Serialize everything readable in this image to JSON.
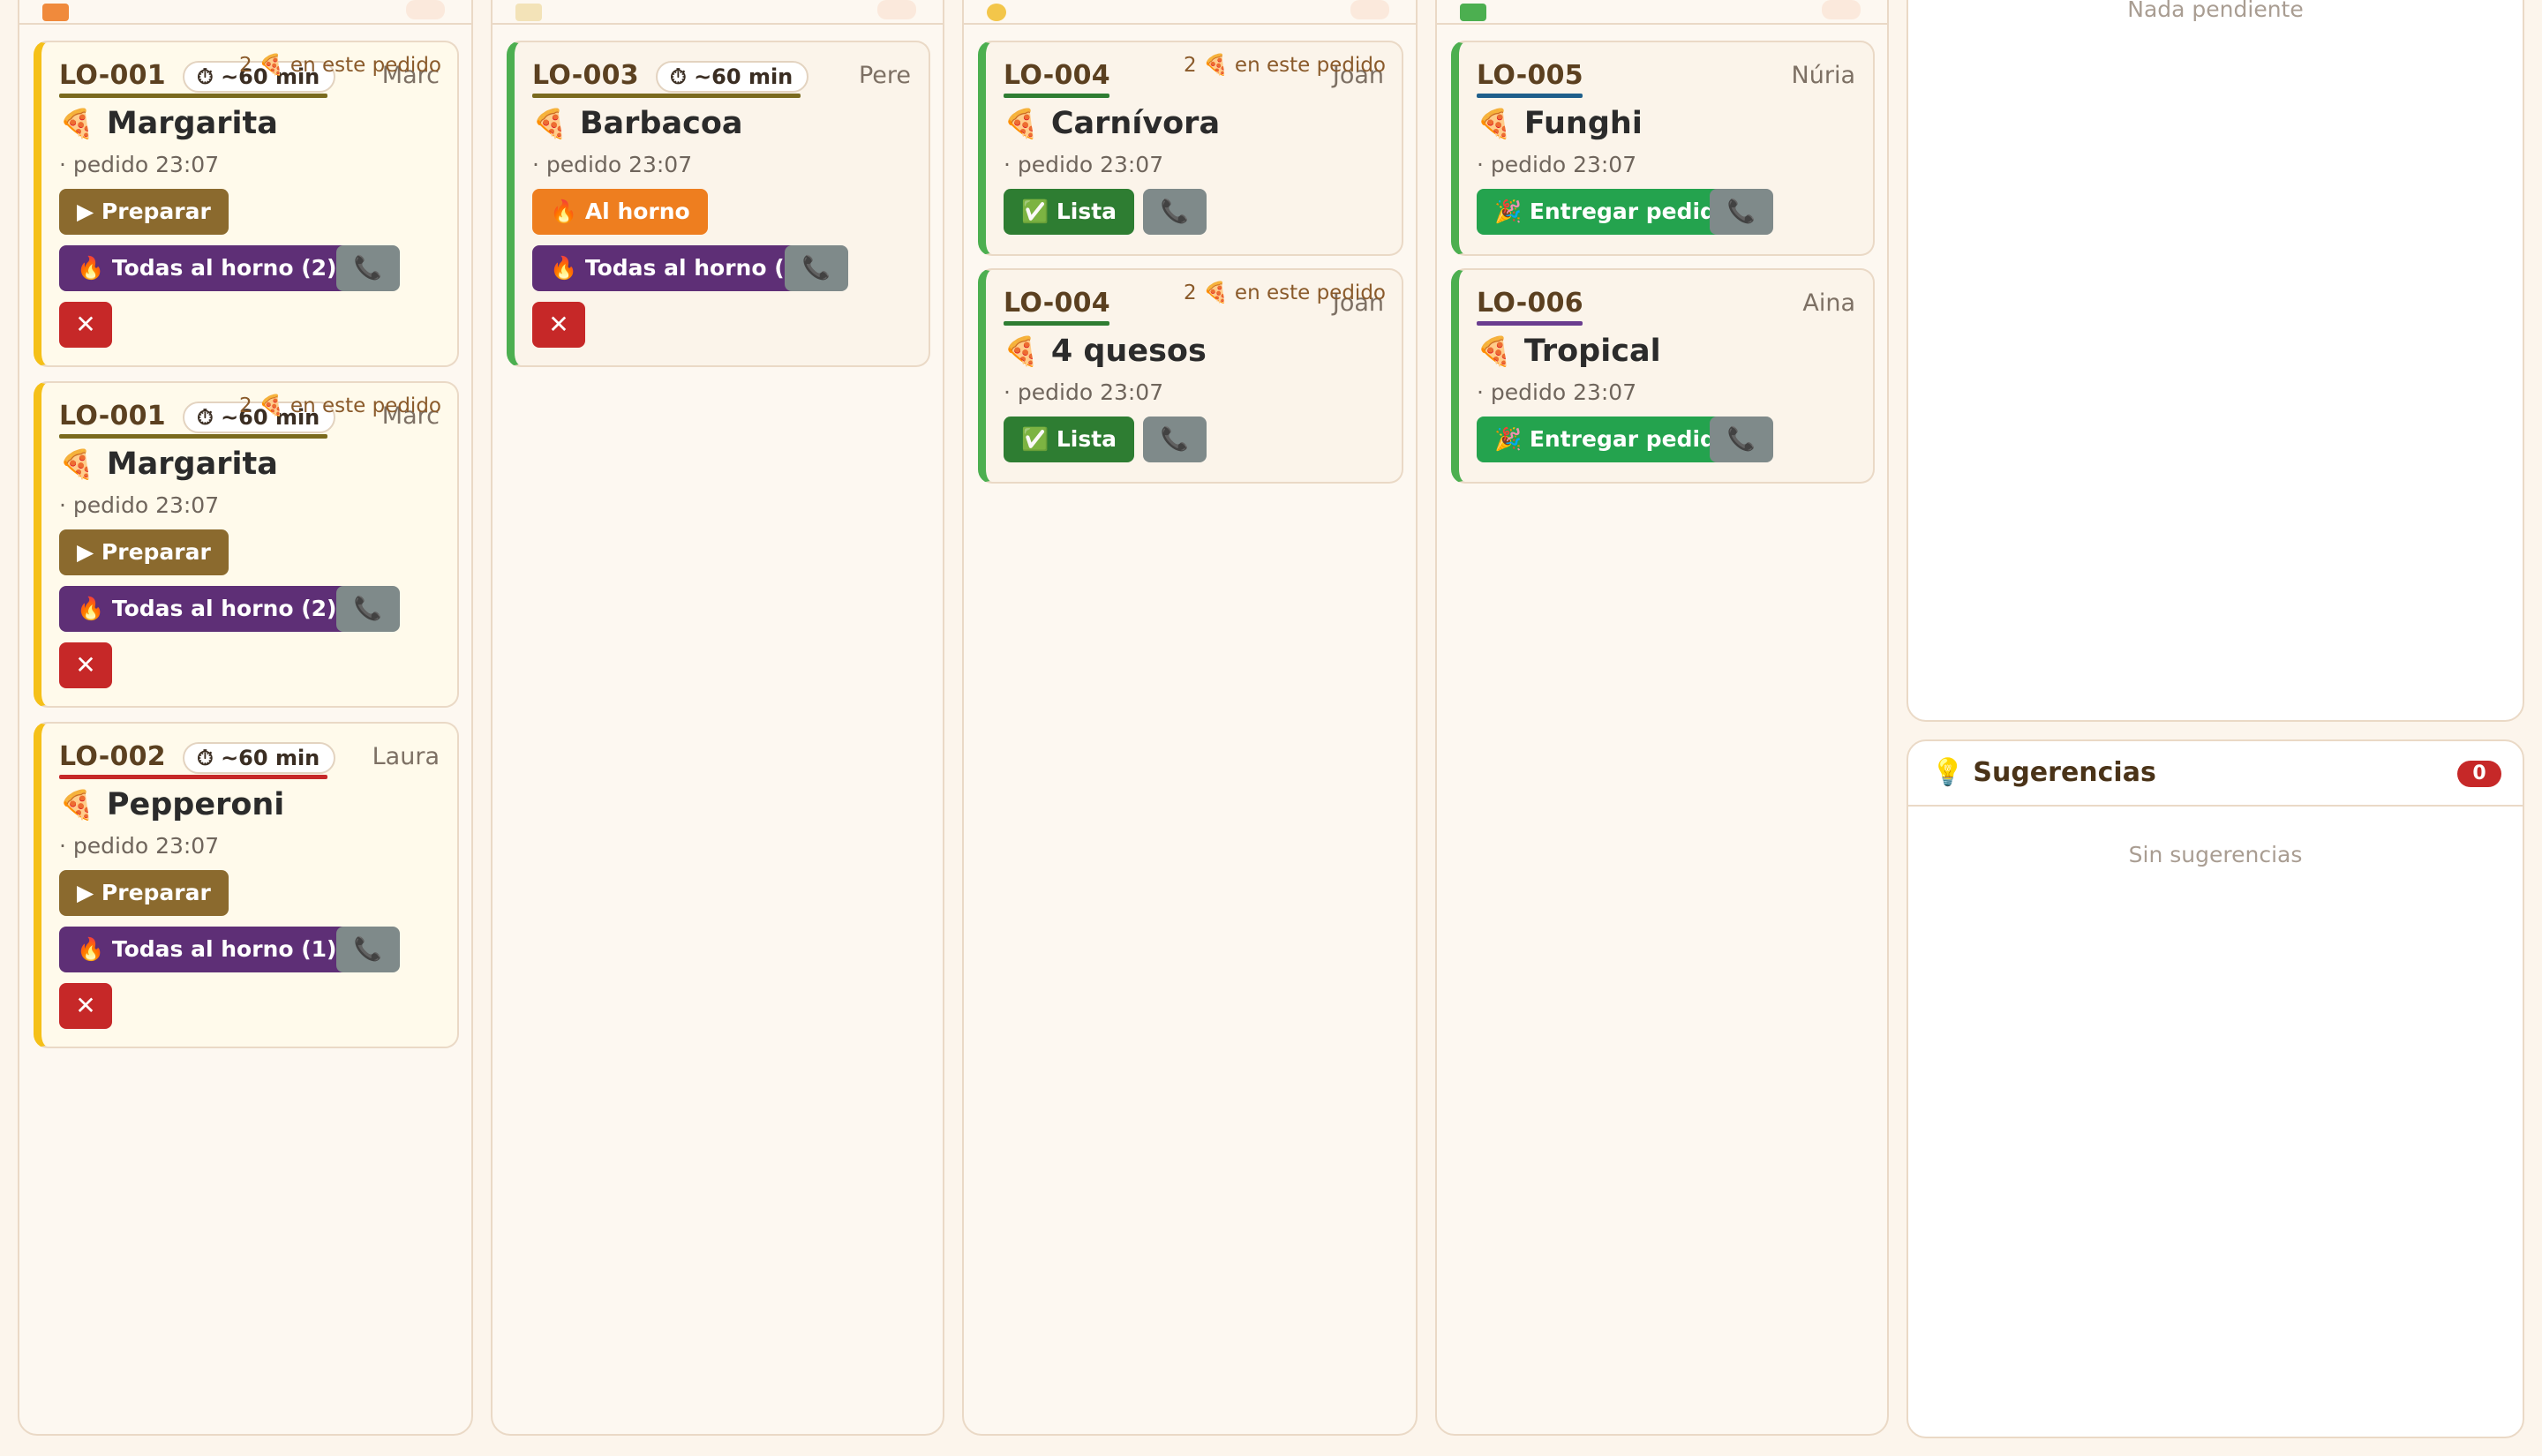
{
  "columns": {
    "pending": {
      "icon_color": "#f08a3c",
      "cards": [
        {
          "id": "LO-001",
          "underline_color": "#7a6a1e",
          "eta": "⏱ ~60 min",
          "customer": "Marc",
          "in_order": "2 🍕 en este pedido",
          "pizza_icon": "🍕",
          "pizza": "Margarita",
          "ordered_at": "· pedido 23:07",
          "prepare_label": "▶ Preparar",
          "oven_all_label": "🔥 Todas al horno (2)",
          "phone_icon": "📞",
          "cancel_label": "✕"
        },
        {
          "id": "LO-001",
          "underline_color": "#7a6a1e",
          "eta": "⏱ ~60 min",
          "customer": "Marc",
          "in_order": "2 🍕 en este pedido",
          "pizza_icon": "🍕",
          "pizza": "Margarita",
          "ordered_at": "· pedido 23:07",
          "prepare_label": "▶ Preparar",
          "oven_all_label": "🔥 Todas al horno (2)",
          "phone_icon": "📞",
          "cancel_label": "✕"
        },
        {
          "id": "LO-002",
          "underline_color": "#c62828",
          "eta": "⏱ ~60 min",
          "customer": "Laura",
          "pizza_icon": "🍕",
          "pizza": "Pepperoni",
          "ordered_at": "· pedido 23:07",
          "prepare_label": "▶ Preparar",
          "oven_all_label": "🔥 Todas al horno (1)",
          "phone_icon": "📞",
          "cancel_label": "✕"
        }
      ]
    },
    "preparing": {
      "icon_color": "#f3e3b8",
      "cards": [
        {
          "id": "LO-003",
          "underline_color": "#7a6a1e",
          "eta": "⏱ ~60 min",
          "customer": "Pere",
          "pizza_icon": "🍕",
          "pizza": "Barbacoa",
          "ordered_at": "· pedido 23:07",
          "oven_label": "🔥 Al horno",
          "oven_all_label": "🔥 Todas al horno (1)",
          "phone_icon": "📞",
          "cancel_label": "✕"
        }
      ]
    },
    "oven": {
      "icon_color": "#f3c64a",
      "cards": [
        {
          "id": "LO-004",
          "underline_color": "#2e7d32",
          "customer": "Joan",
          "in_order": "2 🍕 en este pedido",
          "pizza_icon": "🍕",
          "pizza": "Carnívora",
          "ordered_at": "· pedido 23:07",
          "ready_label": "✅ Lista",
          "phone_icon": "📞"
        },
        {
          "id": "LO-004",
          "underline_color": "#2e7d32",
          "customer": "Joan",
          "in_order": "2 🍕 en este pedido",
          "pizza_icon": "🍕",
          "pizza": "4 quesos",
          "ordered_at": "· pedido 23:07",
          "ready_label": "✅ Lista",
          "phone_icon": "📞"
        }
      ]
    },
    "ready": {
      "icon_color": "#4caf50",
      "cards": [
        {
          "id": "LO-005",
          "underline_color": "#1f5f8b",
          "customer": "Núria",
          "pizza_icon": "🍕",
          "pizza": "Funghi",
          "ordered_at": "· pedido 23:07",
          "deliver_label": "🎉 Entregar pedido",
          "phone_icon": "📞"
        },
        {
          "id": "LO-006",
          "underline_color": "#6a3d8f",
          "customer": "Aina",
          "pizza_icon": "🍕",
          "pizza": "Tropical",
          "ordered_at": "· pedido 23:07",
          "deliver_label": "🎉 Entregar pedido",
          "phone_icon": "📞"
        }
      ]
    }
  },
  "side": {
    "pending_empty": "Nada pendiente",
    "suggestions": {
      "icon": "💡",
      "title": "Sugerencias",
      "count": "0",
      "empty": "Sin sugerencias"
    }
  }
}
